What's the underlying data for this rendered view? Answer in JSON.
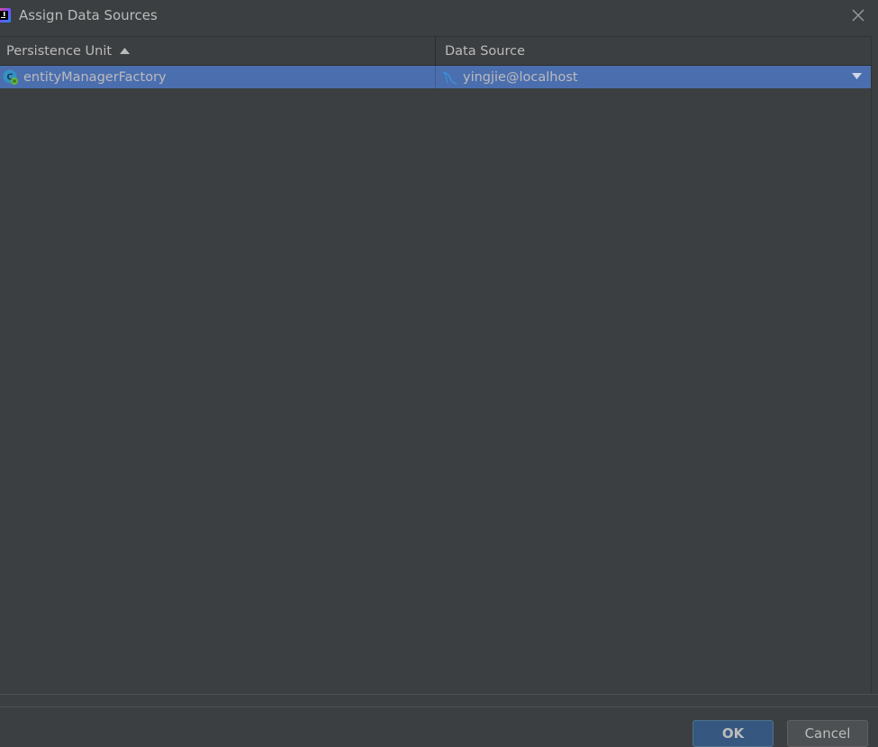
{
  "window": {
    "title": "Assign Data Sources"
  },
  "table": {
    "columns": [
      {
        "label": "Persistence Unit",
        "sort": "ascending"
      },
      {
        "label": "Data Source"
      }
    ],
    "rows": [
      {
        "persistence_unit": "entityManagerFactory",
        "data_source": "yingjie@localhost",
        "selected": true
      }
    ]
  },
  "buttons": {
    "ok_label": "OK",
    "cancel_label": "Cancel"
  },
  "icons": {
    "app": "intellij-icon",
    "close": "close-icon",
    "sort": "sort-ascending-icon",
    "unit": "persistence-unit-icon",
    "datasource": "mysql-datasource-icon",
    "dropdown": "chevron-down-icon"
  },
  "colors": {
    "background": "#3c3f41",
    "selection": "#4b6eaf",
    "ok_button": "#365880",
    "text": "#bbbbbb"
  }
}
